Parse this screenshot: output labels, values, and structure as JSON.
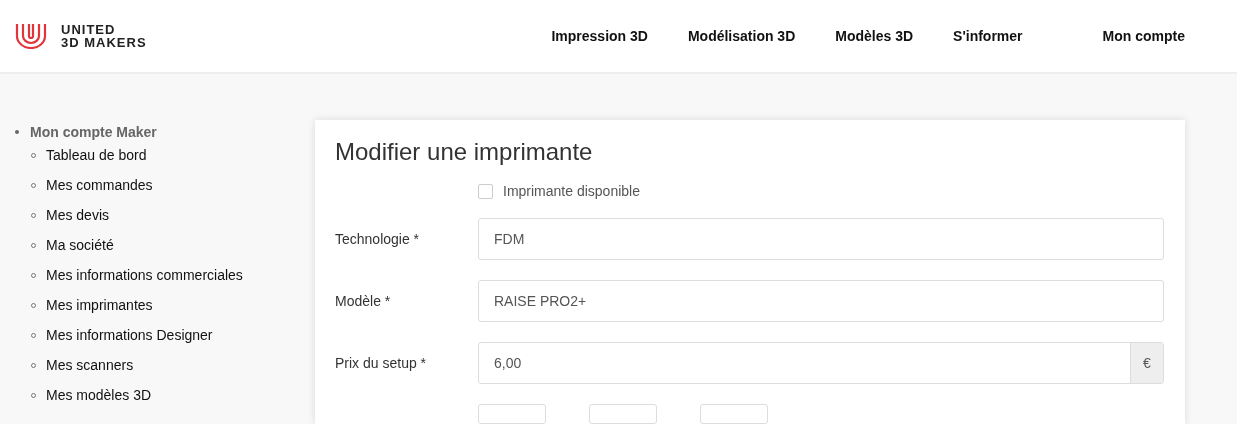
{
  "header": {
    "brand_line_1": "UNITED",
    "brand_line_2": "3D MAKERS",
    "nav": [
      {
        "label": "Impression 3D"
      },
      {
        "label": "Modélisation 3D"
      },
      {
        "label": "Modèles 3D"
      },
      {
        "label": "S'informer"
      },
      {
        "label": "Mon compte"
      }
    ]
  },
  "sidebar": {
    "title": "Mon compte Maker",
    "items": [
      {
        "label": "Tableau de bord"
      },
      {
        "label": "Mes commandes"
      },
      {
        "label": "Mes devis"
      },
      {
        "label": "Ma société"
      },
      {
        "label": "Mes informations commerciales"
      },
      {
        "label": "Mes imprimantes"
      },
      {
        "label": "Mes informations Designer"
      },
      {
        "label": "Mes scanners"
      },
      {
        "label": "Mes modèles 3D"
      }
    ]
  },
  "form": {
    "title": "Modifier une imprimante",
    "available": {
      "label": "Imprimante disponible",
      "checked": false
    },
    "fields": [
      {
        "label": "Technologie *",
        "value": "FDM"
      },
      {
        "label": "Modèle *",
        "value": "RAISE PRO2+"
      },
      {
        "label": "Prix du setup *",
        "value": "6,00",
        "addon": "€"
      }
    ],
    "partial_fields": [
      {
        "kind": "input"
      },
      {
        "kind": "input"
      },
      {
        "kind": "input"
      }
    ]
  }
}
